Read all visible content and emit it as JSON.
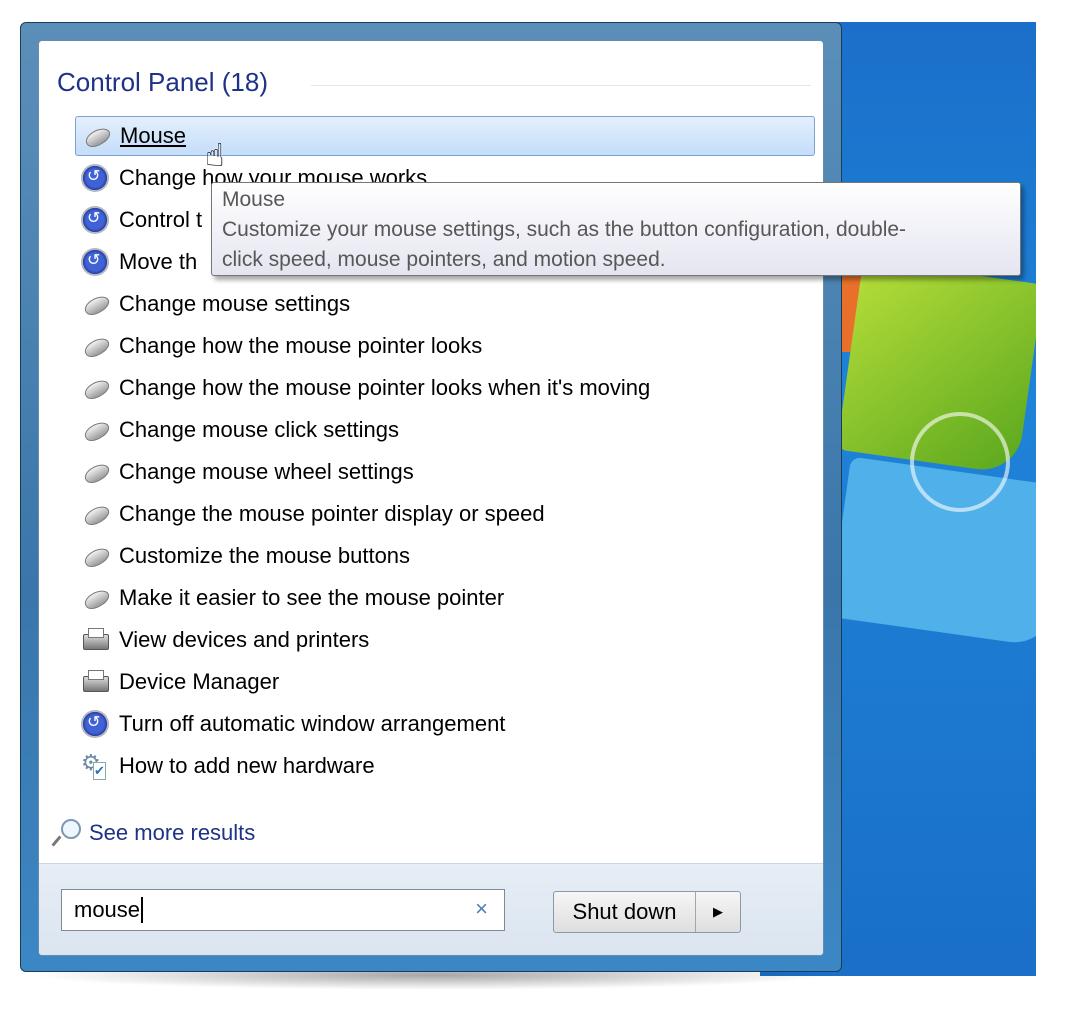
{
  "header": {
    "title": "Control Panel (18)"
  },
  "results": [
    {
      "label": "Mouse",
      "icon": "mouse-icon",
      "selected": true
    },
    {
      "label": "Change how your mouse works",
      "icon": "ease-of-access-icon"
    },
    {
      "label": "Control t",
      "icon": "ease-of-access-icon"
    },
    {
      "label": "Move th",
      "icon": "ease-of-access-icon"
    },
    {
      "label": "Change mouse settings",
      "icon": "mouse-icon"
    },
    {
      "label": "Change how the mouse pointer looks",
      "icon": "mouse-icon"
    },
    {
      "label": "Change how the mouse pointer looks when it's moving",
      "icon": "mouse-icon"
    },
    {
      "label": "Change mouse click settings",
      "icon": "mouse-icon"
    },
    {
      "label": "Change mouse wheel settings",
      "icon": "mouse-icon"
    },
    {
      "label": "Change the mouse pointer display or speed",
      "icon": "mouse-icon"
    },
    {
      "label": "Customize the mouse buttons",
      "icon": "mouse-icon"
    },
    {
      "label": "Make it easier to see the mouse pointer",
      "icon": "mouse-icon"
    },
    {
      "label": "View devices and printers",
      "icon": "printer-icon"
    },
    {
      "label": "Device Manager",
      "icon": "printer-icon"
    },
    {
      "label": "Turn off automatic window arrangement",
      "icon": "ease-of-access-icon"
    },
    {
      "label": "How to add new hardware",
      "icon": "hardware-icon"
    }
  ],
  "tooltip": {
    "title": "Mouse",
    "line1": "Customize your mouse settings, such as the button configuration, double-",
    "line2": "click speed, mouse pointers, and motion speed."
  },
  "see_more": "See more results",
  "search": {
    "value": "mouse",
    "clear": "×"
  },
  "shutdown": {
    "label": "Shut down",
    "arrow": "▶"
  }
}
